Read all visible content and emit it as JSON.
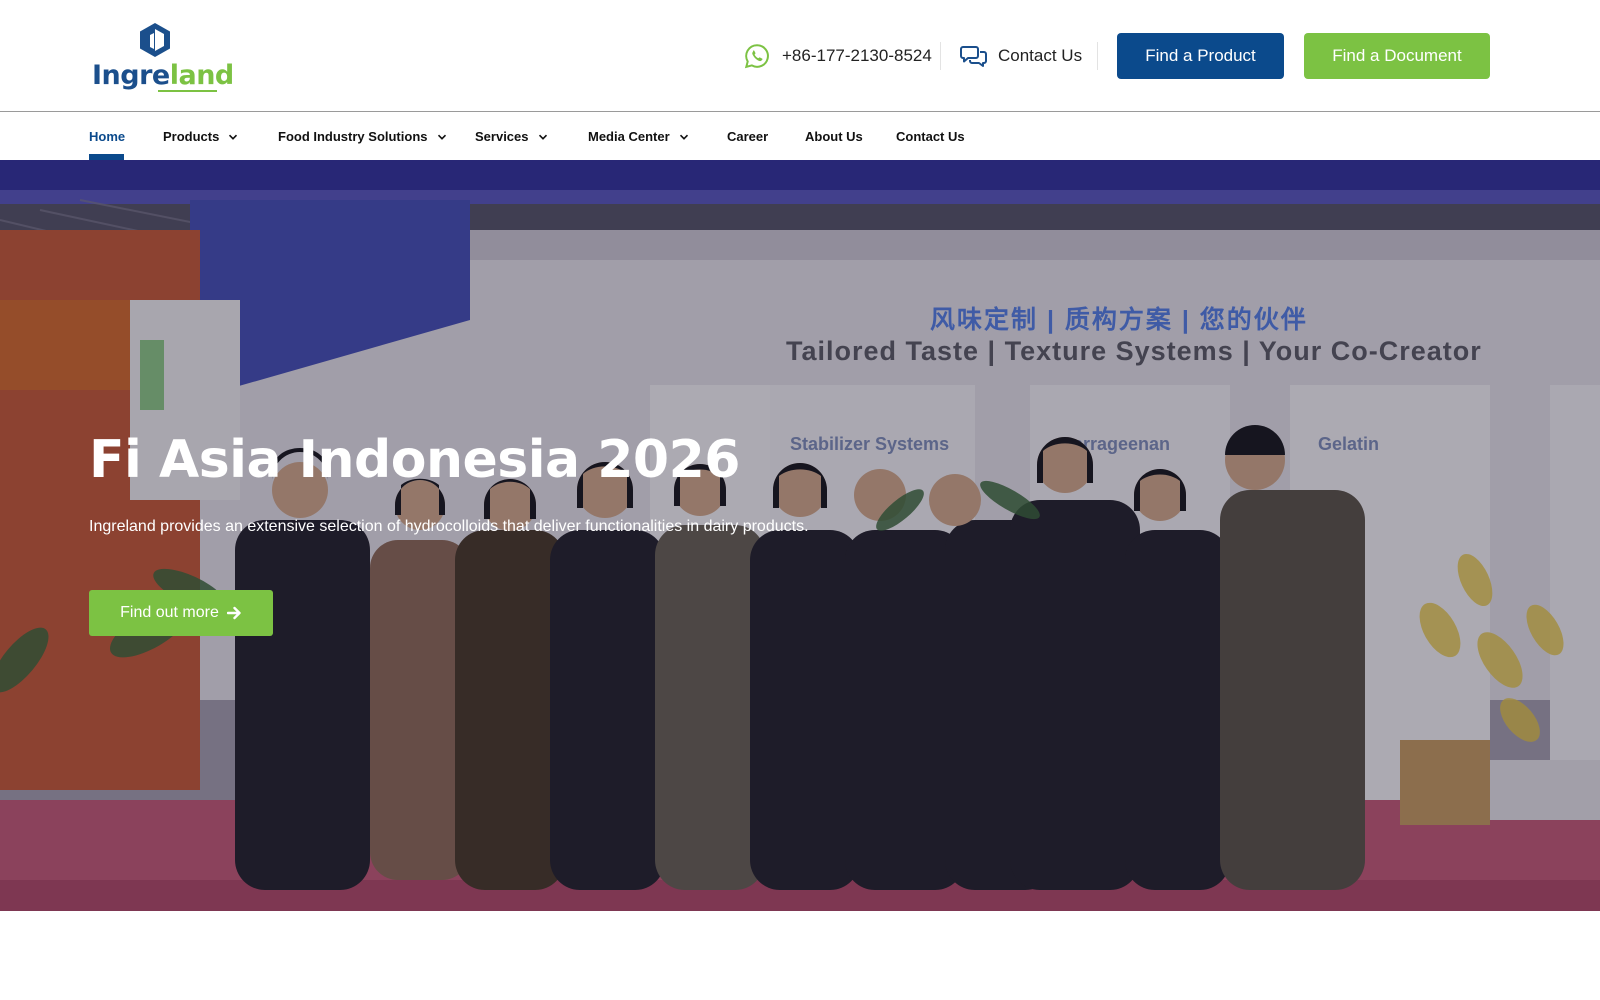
{
  "header": {
    "logo": {
      "text_part1": "Ingre",
      "text_part2": "land",
      "icon": "hexagon-logo-icon"
    },
    "phone": {
      "icon": "whatsapp-icon",
      "number": "+86-177-2130-8524"
    },
    "contact": {
      "icon": "chat-bubbles-icon",
      "label": "Contact Us"
    },
    "buttons": {
      "find_product": "Find a Product",
      "find_document": "Find a Document"
    }
  },
  "nav": {
    "items": [
      {
        "label": "Home",
        "active": true,
        "dropdown": false
      },
      {
        "label": "Products",
        "active": false,
        "dropdown": true
      },
      {
        "label": "Food Industry Solutions",
        "active": false,
        "dropdown": true
      },
      {
        "label": "Services",
        "active": false,
        "dropdown": true
      },
      {
        "label": "Media Center",
        "active": false,
        "dropdown": true
      },
      {
        "label": "Career",
        "active": false,
        "dropdown": false
      },
      {
        "label": "About Us",
        "active": false,
        "dropdown": false
      },
      {
        "label": "Contact Us",
        "active": false,
        "dropdown": false
      }
    ]
  },
  "hero": {
    "title": "Fi Asia Indonesia 2026",
    "subtitle": "Ingreland provides an extensive selection of hydrocolloids that deliver functionalities in dairy products.",
    "cta": "Find out more",
    "cta_icon": "arrow-right-icon",
    "booth_slogan_cn": "风味定制 | 质构方案 | 您的伙伴",
    "booth_slogan_en": "Tailored Taste | Texture Systems | Your Co-Creator"
  },
  "colors": {
    "brand_blue": "#0b4a8c",
    "brand_green": "#7cc243",
    "logo_blue": "#1b4f8c"
  }
}
